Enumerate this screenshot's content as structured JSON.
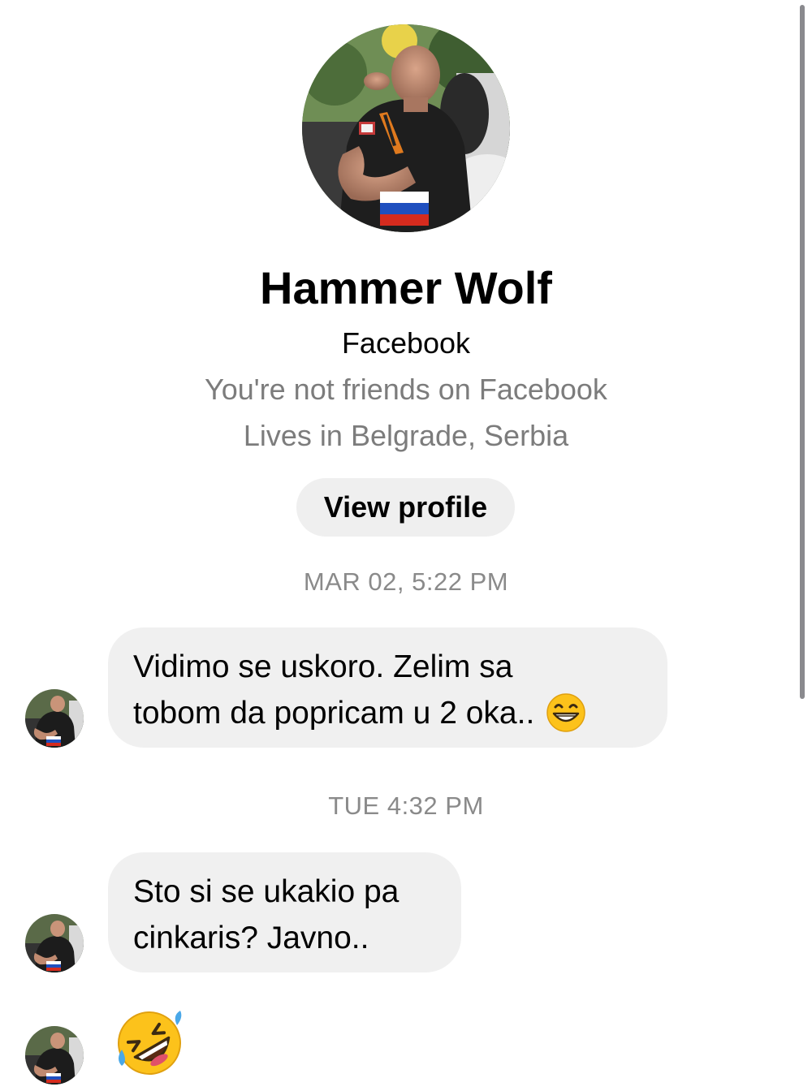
{
  "profile": {
    "name": "Hammer Wolf",
    "source": "Facebook",
    "friend_status": "You're not friends on Facebook",
    "location": "Lives in Belgrade, Serbia",
    "view_profile_label": "View profile"
  },
  "conversation": {
    "timestamps": [
      "MAR 02, 5:22 PM",
      "TUE 4:32 PM"
    ],
    "messages": [
      {
        "lines": [
          "Vidimo se uskoro. Zelim sa",
          "tobom da popricam u 2 oka.."
        ],
        "emoji": "grinning-face-with-smiling-eyes"
      },
      {
        "lines": [
          "Sto si se ukakio pa",
          "cinkaris? Javno.."
        ]
      },
      {
        "emoji": "rolling-on-the-floor-laughing"
      }
    ]
  },
  "colors": {
    "bubble_bg": "#f0f0f0",
    "button_bg": "#efefef",
    "secondary_text": "#7c7c7c",
    "timestamp_text": "#8a8a8a",
    "scrollbar": "#8a8a8e",
    "emoji_yellow": "#fcc21b"
  },
  "icons": {
    "profile_photo": "avatar-photo",
    "emoji_1": "grinning-face-emoji",
    "emoji_2": "rolling-on-floor-laughing-emoji"
  }
}
